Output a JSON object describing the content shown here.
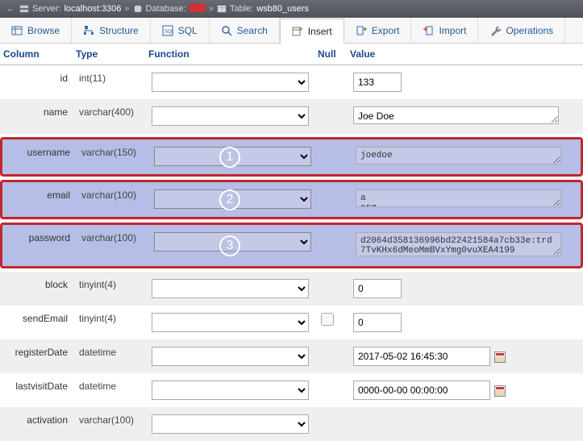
{
  "breadcrumb": {
    "server_label": "Server:",
    "server_value": "localhost:3306",
    "database_label": "Database:",
    "database_value": "",
    "table_label": "Table:",
    "table_value": "wsb80_users"
  },
  "tabs": {
    "browse": "Browse",
    "structure": "Structure",
    "sql": "SQL",
    "search": "Search",
    "insert": "Insert",
    "export": "Export",
    "import": "Import",
    "operations": "Operations"
  },
  "headers": {
    "column": "Column",
    "type": "Type",
    "function": "Function",
    "null": "Null",
    "value": "Value"
  },
  "rows": {
    "id": {
      "name": "id",
      "type": "int(11)",
      "value": "133"
    },
    "name": {
      "name": "name",
      "type": "varchar(400)",
      "value": "Joe Doe"
    },
    "username": {
      "name": "username",
      "type": "varchar(150)",
      "value": "joedoe"
    },
    "email": {
      "name": "email",
      "type": "varchar(100)",
      "value": "a                                     org"
    },
    "password": {
      "name": "password",
      "type": "varchar(100)",
      "value": "d2064d358136996bd22421584a7cb33e:trd7TvKHx6dMeoMmBVxYmg0vuXEA4199"
    },
    "block": {
      "name": "block",
      "type": "tinyint(4)",
      "value": "0"
    },
    "sendEmail": {
      "name": "sendEmail",
      "type": "tinyint(4)",
      "value": "0"
    },
    "registerDate": {
      "name": "registerDate",
      "type": "datetime",
      "value": "2017-05-02 16:45:30"
    },
    "lastvisitDate": {
      "name": "lastvisitDate",
      "type": "datetime",
      "value": "0000-00-00 00:00:00"
    },
    "activation": {
      "name": "activation",
      "type": "varchar(100)",
      "value": ""
    }
  },
  "annotations": {
    "c1": "1",
    "c2": "2",
    "c3": "3"
  }
}
